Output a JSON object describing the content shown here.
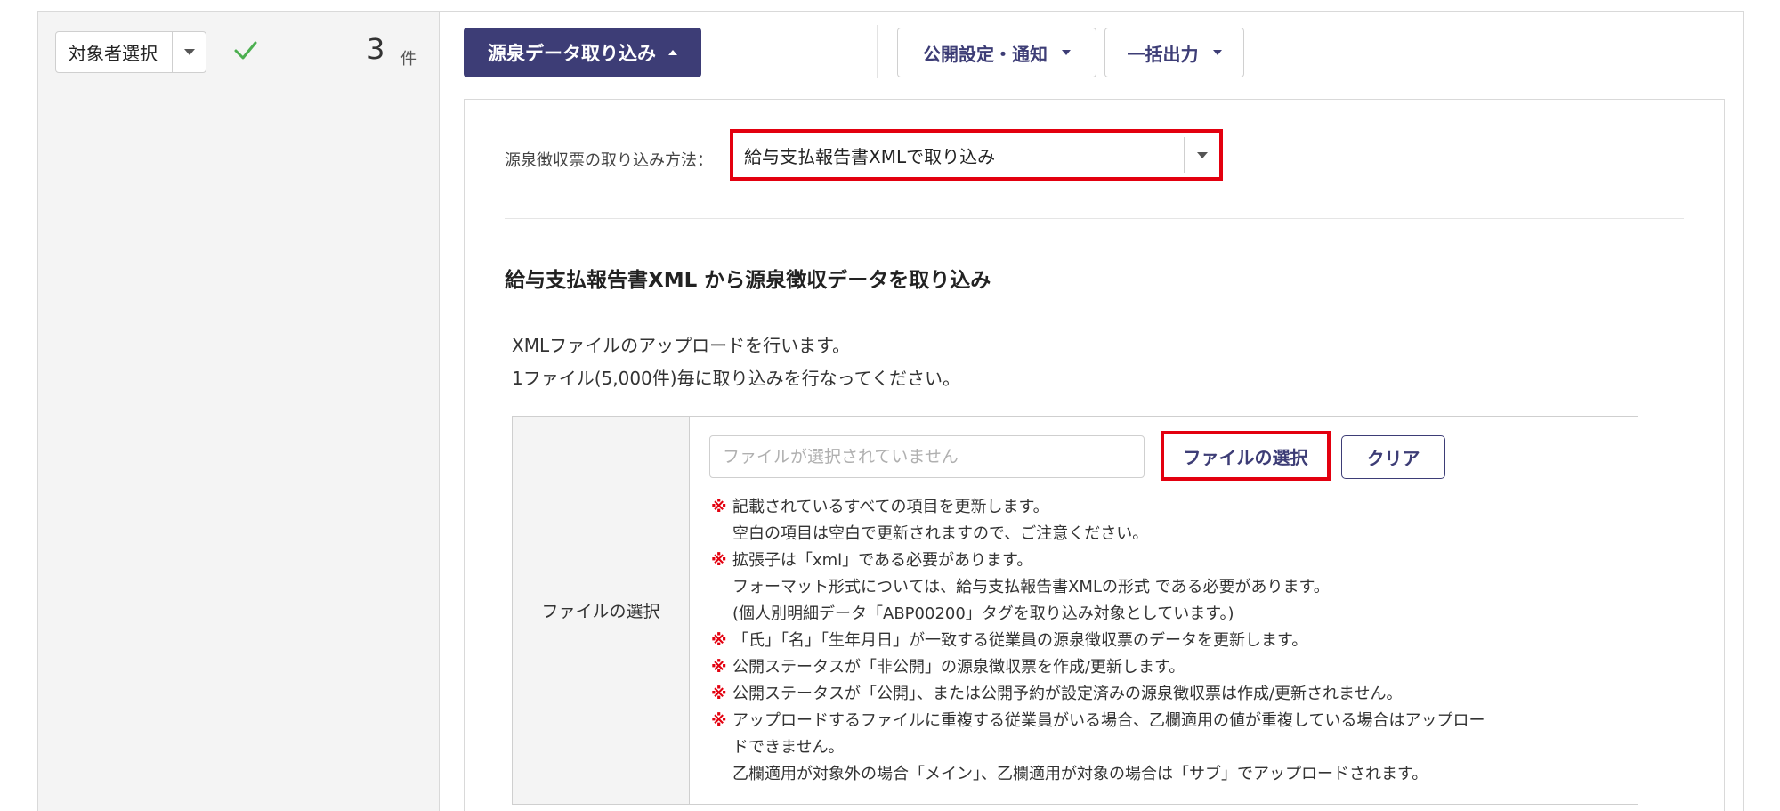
{
  "toolbar": {
    "target_select_label": "対象者選択",
    "count": "3",
    "count_unit": "件",
    "import_button": "源泉データ取り込み",
    "publish_button": "公開設定・通知",
    "export_button": "一括出力"
  },
  "import_panel": {
    "method_label": "源泉徴収票の取り込み方法：",
    "method_value": "給与支払報告書XMLで取り込み",
    "section_title": "給与支払報告書XML から源泉徴収データを取り込み",
    "description": [
      "XMLファイルのアップロードを行います。",
      "1ファイル(5,000件)毎に取り込みを行なってください。"
    ],
    "file_row_label": "ファイルの選択",
    "file_input_placeholder": "ファイルが選択されていません",
    "choose_file_button": "ファイルの選択",
    "clear_button": "クリア",
    "note_mark": "※",
    "notes": [
      {
        "lines": [
          "記載されているすべての項目を更新します。",
          "空白の項目は空白で更新されますので、ご注意ください。"
        ]
      },
      {
        "lines": [
          "拡張子は「xml」である必要があります。",
          "フォーマット形式については、給与支払報告書XMLの形式 である必要があります。",
          "(個人別明細データ「ABP00200」タグを取り込み対象としています。)"
        ]
      },
      {
        "lines": [
          "「氏」「名」「生年月日」が一致する従業員の源泉徴収票のデータを更新します。"
        ]
      },
      {
        "lines": [
          "公開ステータスが「非公開」の源泉徴収票を作成/更新します。"
        ]
      },
      {
        "lines": [
          "公開ステータスが「公開」、または公開予約が設定済みの源泉徴収票は作成/更新されません。"
        ]
      },
      {
        "lines": [
          "アップロードするファイルに重複する従業員がいる場合、乙欄適用の値が重複している場合はアップロー",
          "ドできません。",
          "乙欄適用が対象外の場合「メイン」、乙欄適用が対象の場合は「サブ」でアップロードされます。"
        ]
      }
    ]
  },
  "colors": {
    "brand_navy": "#3d3d76",
    "highlight_red": "#e3000f",
    "check_green": "#4caf50"
  }
}
